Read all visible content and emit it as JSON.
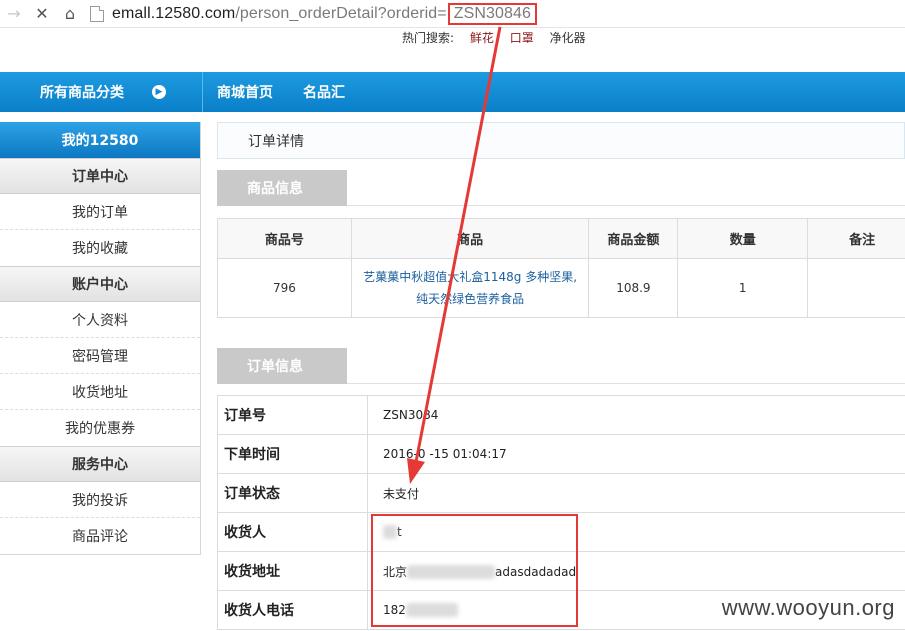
{
  "browser": {
    "back_icon": "back-arrow-icon",
    "url_domain": "emall.12580.com",
    "url_path": "/person_orderDetail?orderid=",
    "url_orderid": "ZSN30846"
  },
  "hot_search": {
    "label": "热门搜索:",
    "items": [
      "鲜花",
      "口罩",
      "净化器"
    ]
  },
  "navbar": {
    "all_categories": "所有商品分类",
    "links": [
      "商城首页",
      "名品汇"
    ]
  },
  "sidebar": {
    "title": "我的12580",
    "groups": [
      {
        "header": "订单中心",
        "items": [
          "我的订单",
          "我的收藏"
        ]
      },
      {
        "header": "账户中心",
        "items": [
          "个人资料",
          "密码管理",
          "收货地址",
          "我的优惠券"
        ]
      },
      {
        "header": "服务中心",
        "items": [
          "我的投诉",
          "商品评论"
        ]
      }
    ]
  },
  "breadcrumb": "订单详情",
  "product_section": {
    "tab": "商品信息",
    "headers": [
      "商品号",
      "商品",
      "商品金额",
      "数量",
      "备注"
    ],
    "row": {
      "id": "796",
      "name_line1": "艺菓菓中秋超值大礼盒1148g 多种坚果,",
      "name_line2": "纯天然绿色营养食品",
      "amount": "108.9",
      "qty": "1",
      "note": ""
    }
  },
  "order_section": {
    "tab": "订单信息",
    "rows": [
      {
        "label": "订单号",
        "value": "ZSN3084"
      },
      {
        "label": "下单时间",
        "value": "2016-0  -15 01:04:17"
      },
      {
        "label": "订单状态",
        "value": "未支付"
      },
      {
        "label": "收货人",
        "value": "t"
      },
      {
        "label": "收货地址",
        "value": "adasdadadad",
        "prefix": "北京"
      },
      {
        "label": "收货人电话",
        "value": "182"
      }
    ]
  },
  "watermark": "www.wooyun.org",
  "colors": {
    "accent": "#0a7fc9",
    "highlight": "#e53935"
  }
}
